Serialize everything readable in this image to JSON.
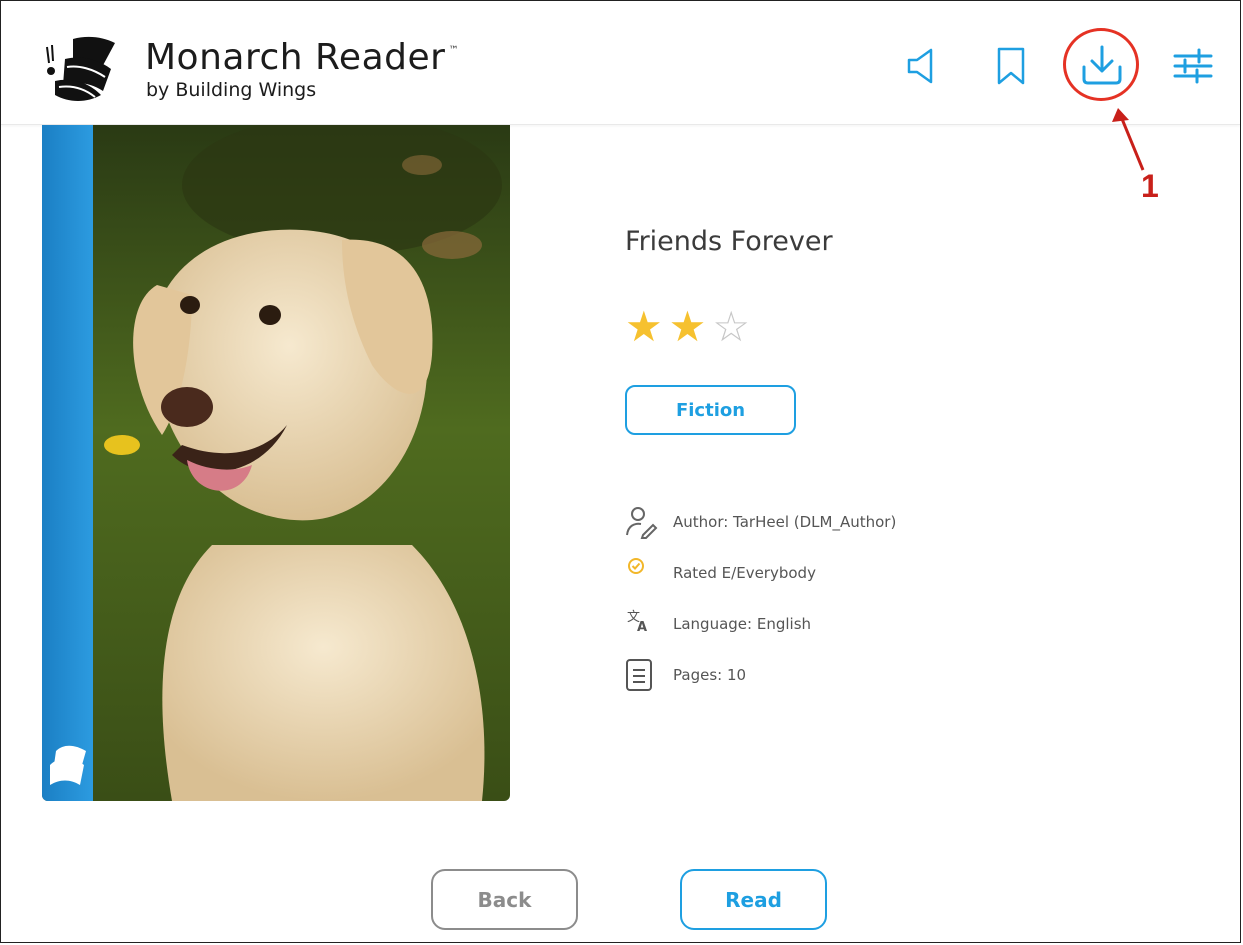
{
  "header": {
    "brand_title": "Monarch Reader",
    "brand_tm": "™",
    "brand_subtitle": "by Building Wings",
    "icons": [
      "speaker-icon",
      "bookmark-icon",
      "download-icon",
      "settings-sliders-icon"
    ],
    "accent_color": "#1e9fe1"
  },
  "annotation": {
    "number": "1",
    "color": "#e53224"
  },
  "book": {
    "title": "Friends Forever",
    "rating": 2,
    "rating_max": 3,
    "genre": "Fiction",
    "meta": {
      "author": "Author: TarHeel (DLM_Author)",
      "rating_label": "Rated E/Everybody",
      "language": "Language: English",
      "pages": "Pages: 10"
    }
  },
  "actions": {
    "back_label": "Back",
    "read_label": "Read"
  }
}
